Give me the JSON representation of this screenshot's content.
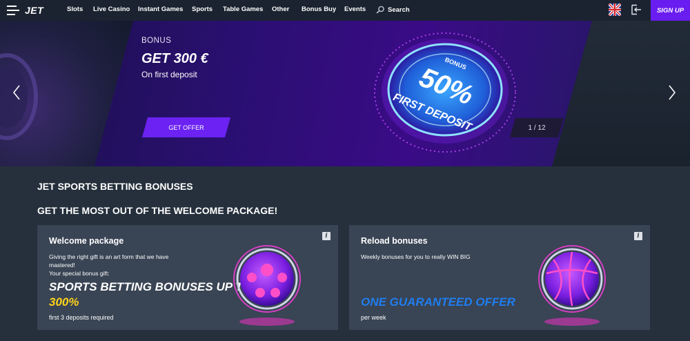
{
  "header": {
    "logo": "JET",
    "nav": [
      "Slots",
      "Live Casino",
      "Instant Games",
      "Sports",
      "Table Games",
      "Other",
      "Bonus Buy",
      "Events"
    ],
    "search_label": "Search",
    "signup_label": "SIGN UP",
    "colors": {
      "bar": "#1b2330",
      "signup": "#6a1df0"
    }
  },
  "hero": {
    "bonus_label": "BONUS",
    "title": "GET 300 €",
    "subtitle": "On first deposit",
    "cta": "GET OFFER",
    "counter": "1 / 12",
    "badge": {
      "top": "BONUS",
      "big": "50%",
      "bottom": "FIRST DEPOSIT"
    }
  },
  "section": {
    "heading1": "JET SPORTS BETTING BONUSES",
    "heading2": "GET THE MOST OUT OF THE WELCOME PACKAGE!"
  },
  "cards": [
    {
      "title": "Welcome package",
      "text_lines": [
        "Giving the right gift is an art form that we have",
        "mastered!",
        "Your special bonus gift:"
      ],
      "promo_line1": "SPORTS BETTING BONUSES UP TO",
      "promo_line2": "300%",
      "note": "first 3 deposits required"
    },
    {
      "title": "Reload bonuses",
      "text": "Weekly bonuses for you to really WIN BIG",
      "promo": "ONE GUARANTEED OFFER",
      "note": "per week"
    }
  ],
  "colors": {
    "accent": "#6b22f2",
    "yellow": "#ffd21a",
    "blue_promo": "#1f7ef0",
    "card_bg": "#394454",
    "page_bg": "#26303c"
  }
}
